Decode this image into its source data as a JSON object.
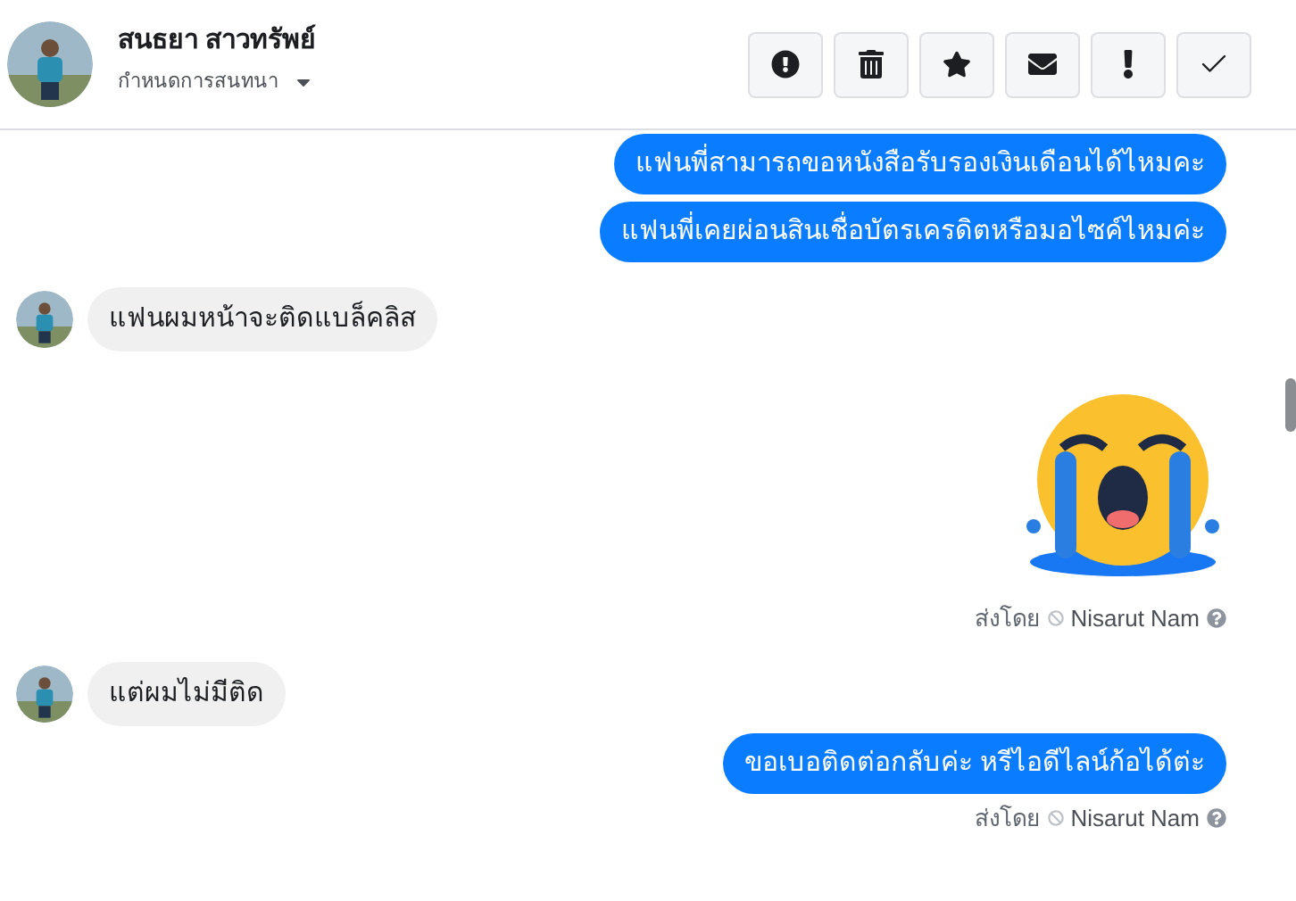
{
  "header": {
    "name": "สนธยา สาวทรัพย์",
    "subtitle": "กำหนดการสนทนา"
  },
  "toolbar": [
    {
      "kind": "alert"
    },
    {
      "kind": "trash"
    },
    {
      "kind": "star"
    },
    {
      "kind": "mail"
    },
    {
      "kind": "exclaim"
    },
    {
      "kind": "check"
    }
  ],
  "messages": [
    {
      "kind": "outgoing",
      "text": "แฟนพี่สามารถขอหนังสือรับรองเงินเดือนได้ไหมคะ"
    },
    {
      "kind": "outgoing",
      "text": "แฟนพี่เคยผ่อนสินเชื่อบัตรเครดิตหรือมอไซค์ไหมค่ะ"
    },
    {
      "kind": "incoming",
      "text": "แฟนผมหน้าจะติดแบล็คลิส"
    },
    {
      "kind": "sticker",
      "sent_by": {
        "label": "ส่งโดย",
        "name": "Nisarut Nam"
      }
    },
    {
      "kind": "incoming",
      "text": "แต่ผมไม่มีติด"
    },
    {
      "kind": "outgoing",
      "text": "ขอเบอติดต่อกลับค่ะ หรีไอดีไลน์ก้อได้ต่ะ",
      "sent_by": {
        "label": "ส่งโดย",
        "name": "Nisarut Nam"
      }
    }
  ]
}
